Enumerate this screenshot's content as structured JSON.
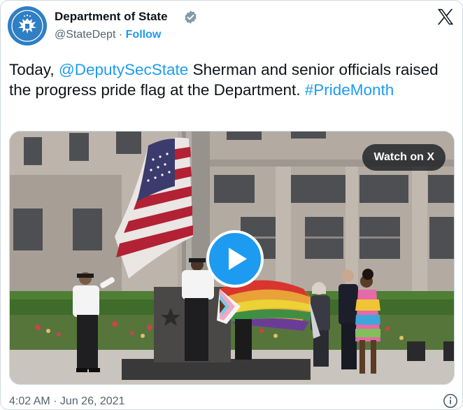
{
  "author": {
    "display_name": "Department of State",
    "handle": "@StateDept",
    "separator": "·",
    "follow_label": "Follow",
    "avatar_icon": "state-department-seal-icon",
    "verified_icon": "verified-badge-icon"
  },
  "platform_icon": "x-logo-icon",
  "tweet": {
    "text_before": "Today, ",
    "mention": "@DeputySecState",
    "text_after": " Sherman and senior officials raised the progress pride flag at the Department. ",
    "hashtag": "#PrideMonth"
  },
  "media": {
    "watch_label": "Watch on X",
    "play_icon": "play-icon"
  },
  "timestamp": "4:02 AM · Jun 26, 2021",
  "info_icon": "info-icon",
  "colors": {
    "link": "#1d9bf0",
    "text": "#0f1419",
    "secondary": "#536471"
  }
}
